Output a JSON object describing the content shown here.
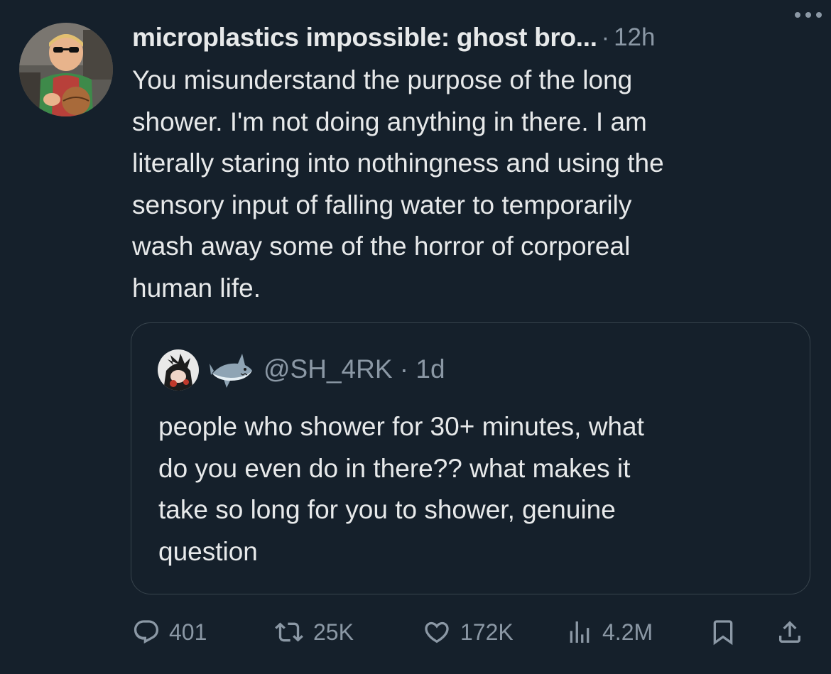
{
  "tweet": {
    "display_name": "microplastics impossible: ghost bro...",
    "separator": "·",
    "time": "12h",
    "body": "You misunderstand the purpose of the long\nshower. I'm not doing anything in there. I am\nliterally staring into nothingness and using the\nsensory input of falling water to temporarily\nwash away some of the horror of corporeal\nhuman life."
  },
  "quote": {
    "handle": "@SH_4RK",
    "separator": "·",
    "time": "1d",
    "emoji_icon": "shark-icon",
    "body": "people who shower for 30+ minutes, what\ndo you even do in there?? what makes it\ntake so long for you to shower, genuine\nquestion"
  },
  "actions": {
    "replies": "401",
    "retweets": "25K",
    "likes": "172K",
    "views": "4.2M"
  },
  "colors": {
    "background": "#15202b",
    "text": "#e7e9ea",
    "secondary": "#8b98a5",
    "border": "#38444d"
  }
}
